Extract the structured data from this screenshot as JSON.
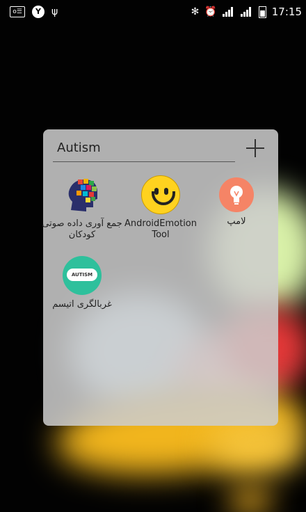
{
  "status_bar": {
    "time": "17:15"
  },
  "folder": {
    "title": "Autism",
    "apps": [
      {
        "label": "جمع آوری داده صوتی کودکان",
        "icon": "puzzle-head-icon"
      },
      {
        "label": "AndroidEmotionTool",
        "icon": "smiley-icon"
      },
      {
        "label": "لامپ",
        "icon": "lamp-icon"
      },
      {
        "label": "غربالگری اتیسم",
        "icon": "autism-icon",
        "icon_text": "AUTISM"
      }
    ]
  },
  "colors": {
    "smiley": "#ffd21f",
    "lamp": "#f58466",
    "autism": "#2ec09c"
  }
}
